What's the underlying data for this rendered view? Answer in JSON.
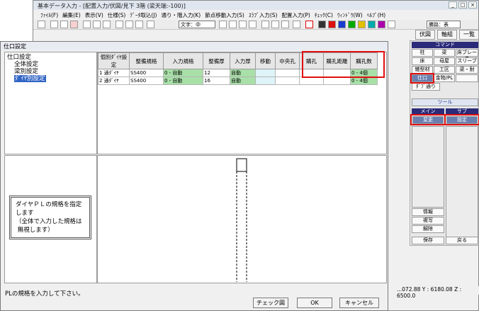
{
  "main_window": {
    "title": "基本データ入力 - [配置入力/伏図/見下 3階 (梁天端:-100)]",
    "menu": [
      "ﾌｧｲﾙ(F)",
      "編集(E)",
      "表示(V)",
      "仕様(S)",
      "ﾃﾞｰﾀ取込(J)",
      "通り・階入力(K)",
      "節点移動入力(S)",
      "ｽﾗﾌﾞ入力(S)",
      "配置入力(P)",
      "ﾁｪｯｸ(C)",
      "ｳｨﾝﾄﾞｳ(W)",
      "ﾍﾙﾌﾟ(H)"
    ],
    "font_combo": "文字：中",
    "scale_combo": "勝路：表",
    "window_buttons": [
      "_",
      "□",
      "×"
    ]
  },
  "right_panel": {
    "top_tabs": [
      "伏図",
      "軸組",
      "一覧"
    ],
    "command_header": "コマンド",
    "command_rows": [
      [
        "柱",
        "梁",
        "床ブレース"
      ],
      [
        "床",
        "母屋",
        "スリーブ"
      ],
      [
        "雑型材",
        "工区",
        "梁・耐"
      ],
      [
        "仕口",
        "金物/PL",
        ""
      ]
    ],
    "wide_button": "ﾀﾞﾌﾞ通り",
    "tool_button": "ツール",
    "main_header": "メイン",
    "sub_header": "サブ",
    "main_sub_buttons": [
      "変更",
      "設定"
    ],
    "lower_buttons": [
      "情報",
      "複写",
      "解除"
    ],
    "save_button": "保存",
    "back_button": "戻る",
    "coords": {
      "x": "...072.88",
      "y": "Y : 6180.08",
      "z": "Z : 6500.0"
    }
  },
  "dialog": {
    "title": "仕口設定",
    "tree": [
      "仕口設定",
      "全体設定",
      "梁別設定",
      "ﾀﾞｲﾔ別設定"
    ],
    "table": {
      "headers": [
        "個別ﾀﾞｲﾔ設定",
        "整備規格",
        "入力規格",
        "整備厚",
        "入力厚",
        "移動",
        "中央孔",
        "購孔",
        "購孔距離",
        "購孔数"
      ],
      "rows": [
        [
          "1 通ﾀﾞｲﾔ",
          "SS400",
          "0 - 自動",
          "12",
          "自動",
          "",
          "",
          "",
          "",
          "0 - 4個"
        ],
        [
          "2 通ﾀﾞｲﾔ",
          "SS400",
          "0 - 自動",
          "16",
          "自動",
          "",
          "",
          "",
          "",
          "0 - 4個"
        ]
      ]
    },
    "help_text": "ダイヤＰＬの規格を指定\nします\n（全体で入力した規格は\n 無視します）",
    "status": "PLの規格を入力して下さい。",
    "buttons": {
      "check": "チェック図",
      "ok": "OK",
      "cancel": "キャンセル"
    }
  },
  "colors": {
    "highlight": "#e01010",
    "selection": "#3165c5",
    "green_cell": "#a8e0a8",
    "cyan_cell": "#dff4f8"
  }
}
